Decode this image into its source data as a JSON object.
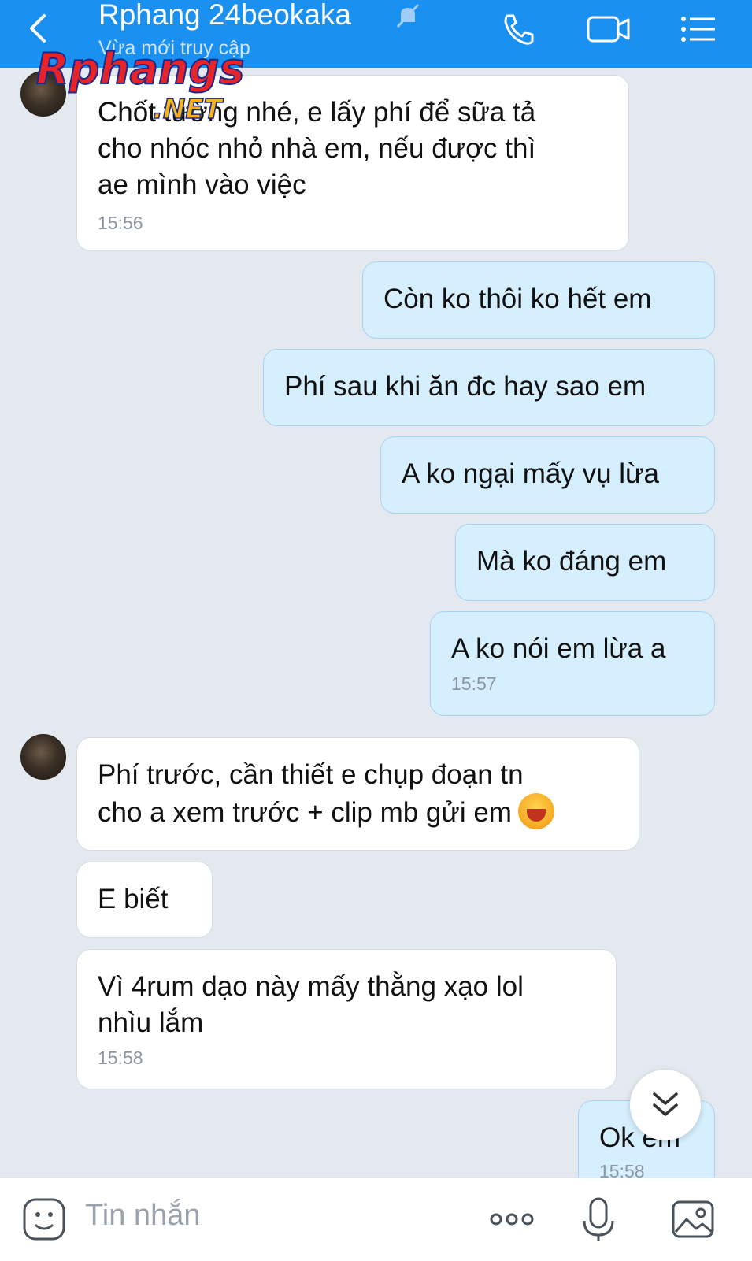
{
  "header": {
    "title": "Rphang 24beokaka",
    "subtitle": "Vừa mới truy cập",
    "icons": [
      "back-icon",
      "muted-bell-icon",
      "phone-icon",
      "video-call-icon",
      "menu-list-icon"
    ]
  },
  "watermark": {
    "brand": "Rphangs",
    "suffix": ".NET"
  },
  "messages": [
    {
      "dir": "in",
      "text": "Chốt tường nhé, e lấy phí để sữa tả\ncho nhóc nhỏ nhà em, nếu được thì\nae mình vào việc",
      "time": "15:56"
    },
    {
      "dir": "out",
      "text": "Còn ko thôi ko hết em"
    },
    {
      "dir": "out",
      "text": "Phí sau khi ăn đc hay sao em"
    },
    {
      "dir": "out",
      "text": "A ko ngại mấy vụ lừa"
    },
    {
      "dir": "out",
      "text": "Mà ko đáng em"
    },
    {
      "dir": "out",
      "text": "A ko nói em lừa a",
      "time": "15:57"
    },
    {
      "dir": "in",
      "text": "Phí trước, cần thiết e chụp đoạn tn\ncho a xem trước + clip mb gửi em"
    },
    {
      "dir": "in",
      "text": "E biết"
    },
    {
      "dir": "in",
      "text": "Vì 4rum dạo này mấy thằng xạo lol\nnhìu lắm",
      "time": "15:58"
    },
    {
      "dir": "out",
      "text": "Ok em",
      "time": "15:58"
    }
  ],
  "composer": {
    "placeholder": "Tin nhắn",
    "icons": [
      "sticker-icon",
      "more-icon",
      "microphone-icon",
      "image-icon"
    ]
  },
  "colors": {
    "header": "#1a90f0",
    "outgoing_bubble": "#d6efff",
    "incoming_bubble": "#ffffff",
    "background": "#e4e9f0"
  }
}
